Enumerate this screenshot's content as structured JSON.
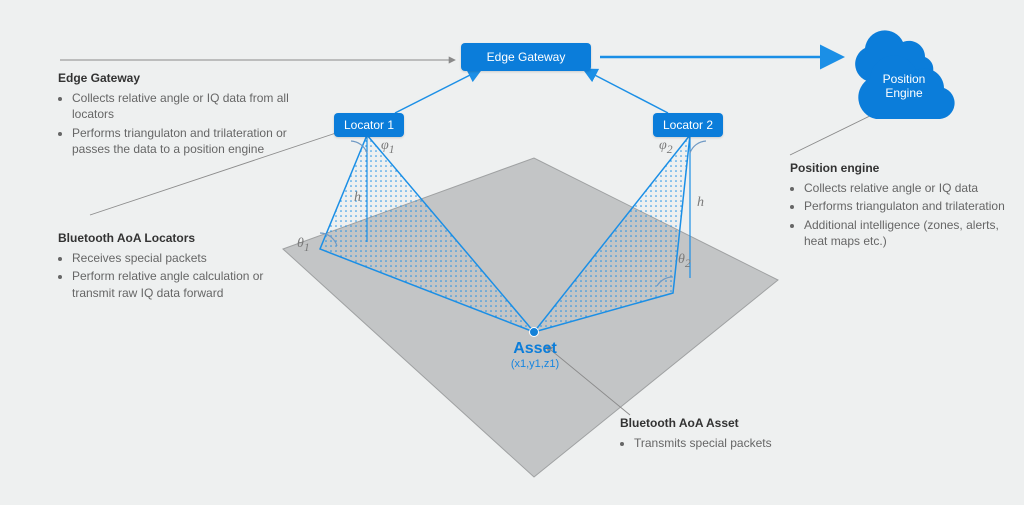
{
  "nodes": {
    "edge_gateway": "Edge Gateway",
    "locator1": "Locator 1",
    "locator2": "Locator 2",
    "asset": "Asset",
    "asset_coords": "(x1,y1,z1)",
    "position_engine_line1": "Position",
    "position_engine_line2": "Engine"
  },
  "symbols": {
    "phi1": "φ",
    "phi1_sub": "1",
    "phi2": "φ",
    "phi2_sub": "2",
    "theta1": "θ",
    "theta1_sub": "1",
    "theta2": "θ",
    "theta2_sub": "2",
    "h": "h"
  },
  "notes": {
    "edge": {
      "title": "Edge Gateway",
      "items": [
        "Collects relative angle or IQ data from all locators",
        "Performs triangulaton and trilateration or passes the data to a position engine"
      ]
    },
    "locators": {
      "title": "Bluetooth AoA Locators",
      "items": [
        "Receives special packets",
        "Perform relative angle calculation or transmit raw IQ data forward"
      ]
    },
    "asset": {
      "title": "Bluetooth AoA Asset",
      "items": [
        "Transmits special packets"
      ]
    },
    "engine": {
      "title": "Position engine",
      "items": [
        "Collects relative angle or IQ data",
        "Performs triangulaton and trilateration",
        "Additional intelligence (zones, alerts, heat maps etc.)"
      ]
    }
  }
}
